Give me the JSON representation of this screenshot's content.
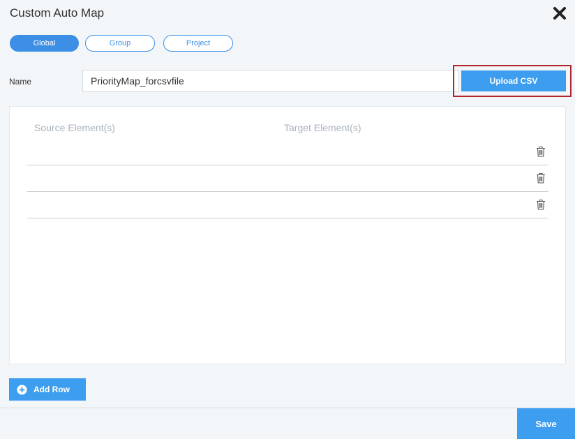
{
  "dialog": {
    "title": "Custom Auto Map"
  },
  "tabs": [
    {
      "label": "Global",
      "active": true
    },
    {
      "label": "Group",
      "active": false
    },
    {
      "label": "Project",
      "active": false
    }
  ],
  "name_field": {
    "label": "Name",
    "value": "PriorityMap_forcsvfile"
  },
  "upload_button": {
    "label": "Upload CSV"
  },
  "mapping_table": {
    "columns": [
      "Source Element(s)",
      "Target Element(s)"
    ],
    "rows": [
      {
        "source": "",
        "target": ""
      },
      {
        "source": "",
        "target": ""
      },
      {
        "source": "",
        "target": ""
      }
    ]
  },
  "add_row_button": {
    "label": "Add Row"
  },
  "save_button": {
    "label": "Save"
  },
  "colors": {
    "accent": "#3d9ef0",
    "background": "#f2f6f9",
    "highlight_border": "#b0252d",
    "placeholder_text": "#a8b1bc"
  },
  "icons": [
    "close-icon",
    "trash-icon",
    "plus-circle-icon"
  ]
}
